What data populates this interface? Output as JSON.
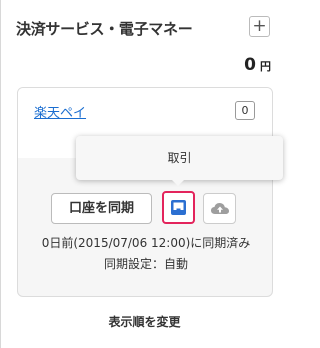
{
  "panel": {
    "title": "決済サービス・電子マネー",
    "add_label": "+",
    "total_amount": "0",
    "total_unit": "円"
  },
  "account_card": {
    "service_name": "楽天ペイ",
    "count": "0",
    "sync_button_label": "口座を同期",
    "transactions_icon": "inbox-tray-icon",
    "upload_icon": "cloud-upload-icon",
    "sync_status": "0日前(2015/07/06 12:00)に同期済み",
    "sync_setting": "同期設定：自動"
  },
  "tooltip": {
    "label": "取引"
  },
  "footer": {
    "reorder_label": "表示順を変更"
  },
  "colors": {
    "link": "#1a6dd0",
    "highlight": "#e3245c",
    "icon_blue": "#2b6fd1",
    "icon_gray": "#9e9e9e"
  }
}
